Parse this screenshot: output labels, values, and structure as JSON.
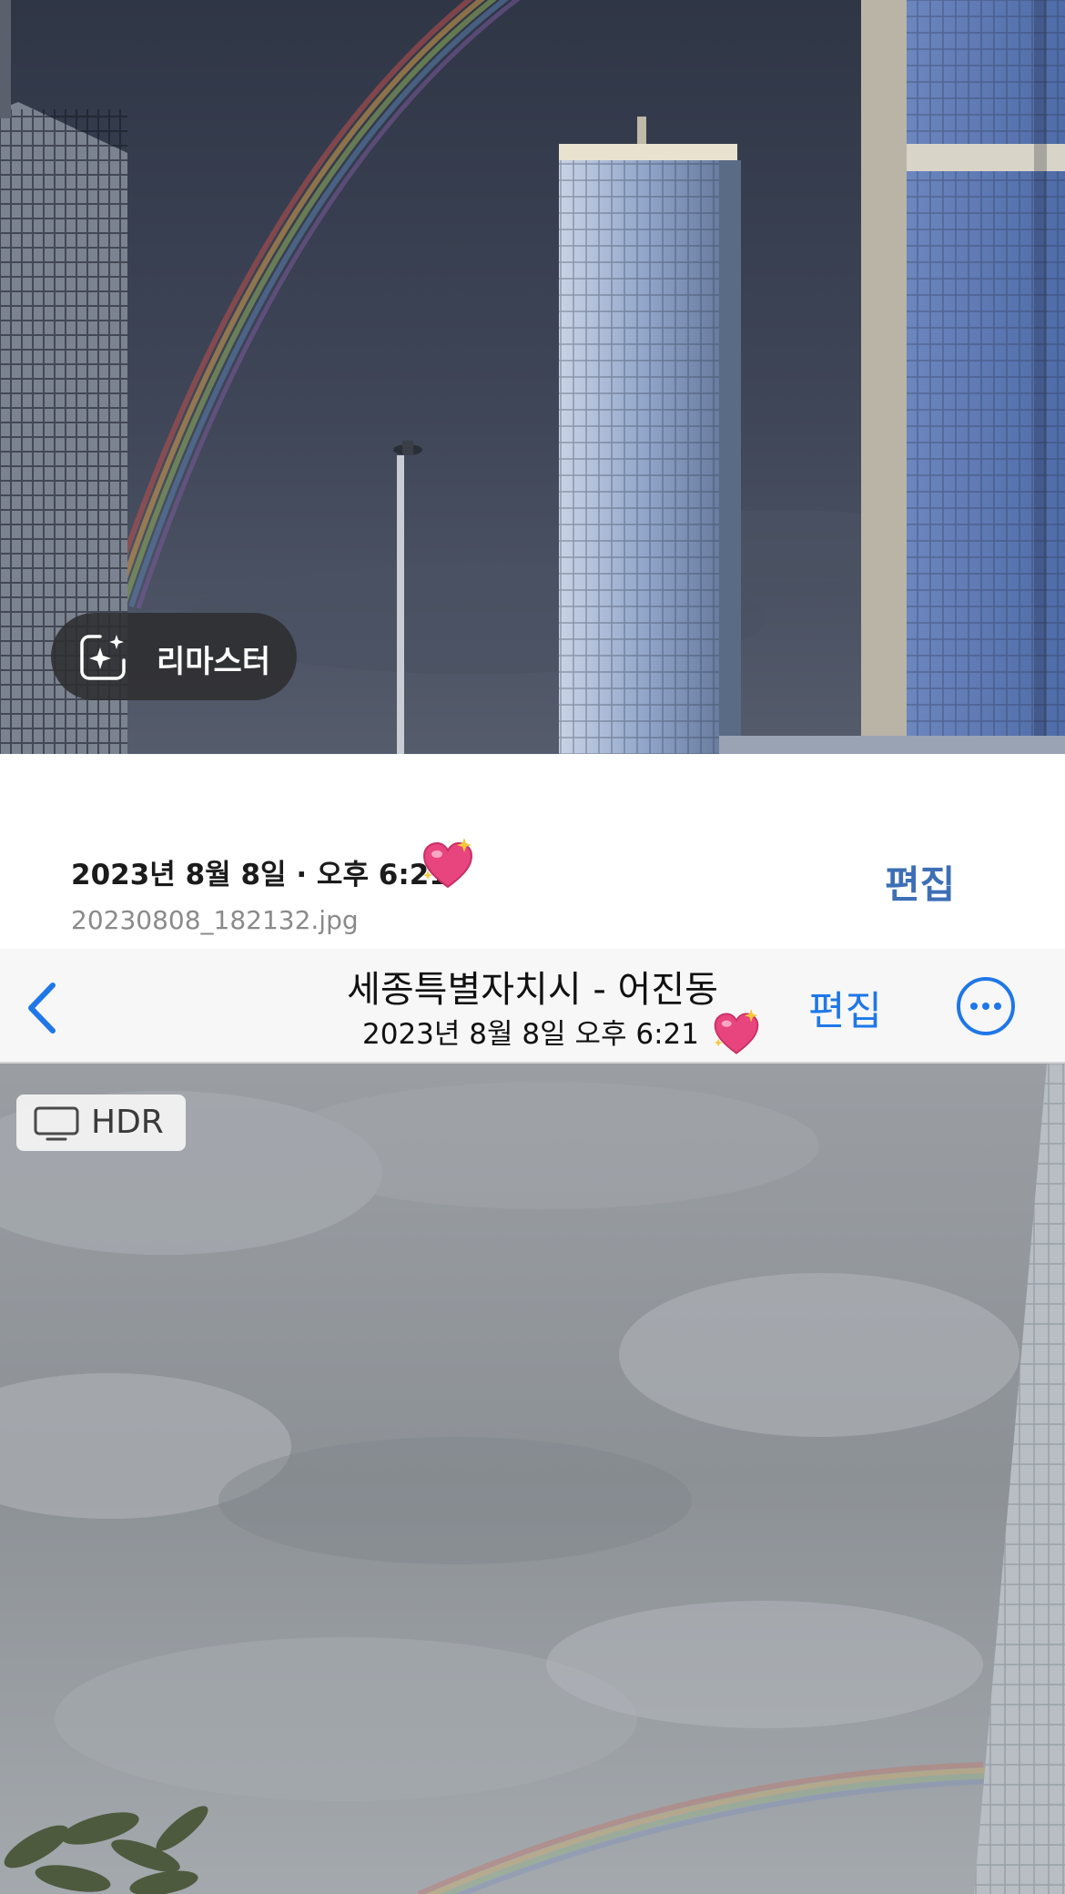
{
  "gallery": {
    "remaster_label": "리마스터",
    "date_time": "2023년 8월 8일 · 오후 6:21",
    "edit_label": "편집",
    "filename": "20230808_182132.jpg"
  },
  "navbar": {
    "title": "세종특별자치시 - 어진동",
    "subtitle": "2023년 8월 8일 오후 6:21",
    "edit_label": "편집"
  },
  "badges": {
    "hdr_label": "HDR"
  },
  "icons": {
    "remaster": "sparkle-square-icon",
    "heart": "sparkling-heart-icon",
    "back": "chevron-left-icon",
    "more": "ellipsis-circle-icon",
    "hdr": "display-icon"
  },
  "colors": {
    "accent_blue": "#1f77e8",
    "gallery_edit_blue": "#3d6fb6",
    "heart_pink": "#e8457e"
  }
}
